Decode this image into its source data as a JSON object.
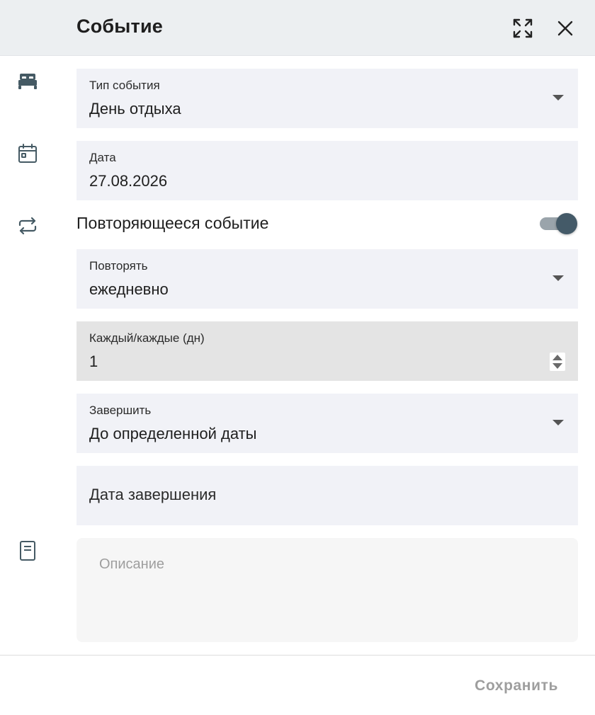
{
  "dialog": {
    "title": "Событие"
  },
  "icons": {
    "expand": "expand-icon",
    "close": "close-icon",
    "bed": "bed-icon",
    "calendar": "calendar-icon",
    "repeat": "repeat-icon",
    "note": "note-icon"
  },
  "event_type": {
    "label": "Тип события",
    "value": "День отдыха"
  },
  "date": {
    "label": "Дата",
    "value": "27.08.2026"
  },
  "recurring": {
    "label": "Повторяющееся событие",
    "enabled": true
  },
  "repeat": {
    "label": "Повторять",
    "value": "ежедневно"
  },
  "interval": {
    "label": "Каждый/каждые (дн)",
    "value": "1"
  },
  "end": {
    "label": "Завершить",
    "value": "До определенной даты"
  },
  "end_date": {
    "placeholder": "Дата завершения"
  },
  "description": {
    "placeholder": "Описание"
  },
  "footer": {
    "save_label": "Сохранить"
  },
  "colors": {
    "header_bg": "#eceff1",
    "field_bg": "#f1f2f7",
    "toggle_thumb": "#445a68",
    "save_disabled": "#9e9e9e"
  }
}
